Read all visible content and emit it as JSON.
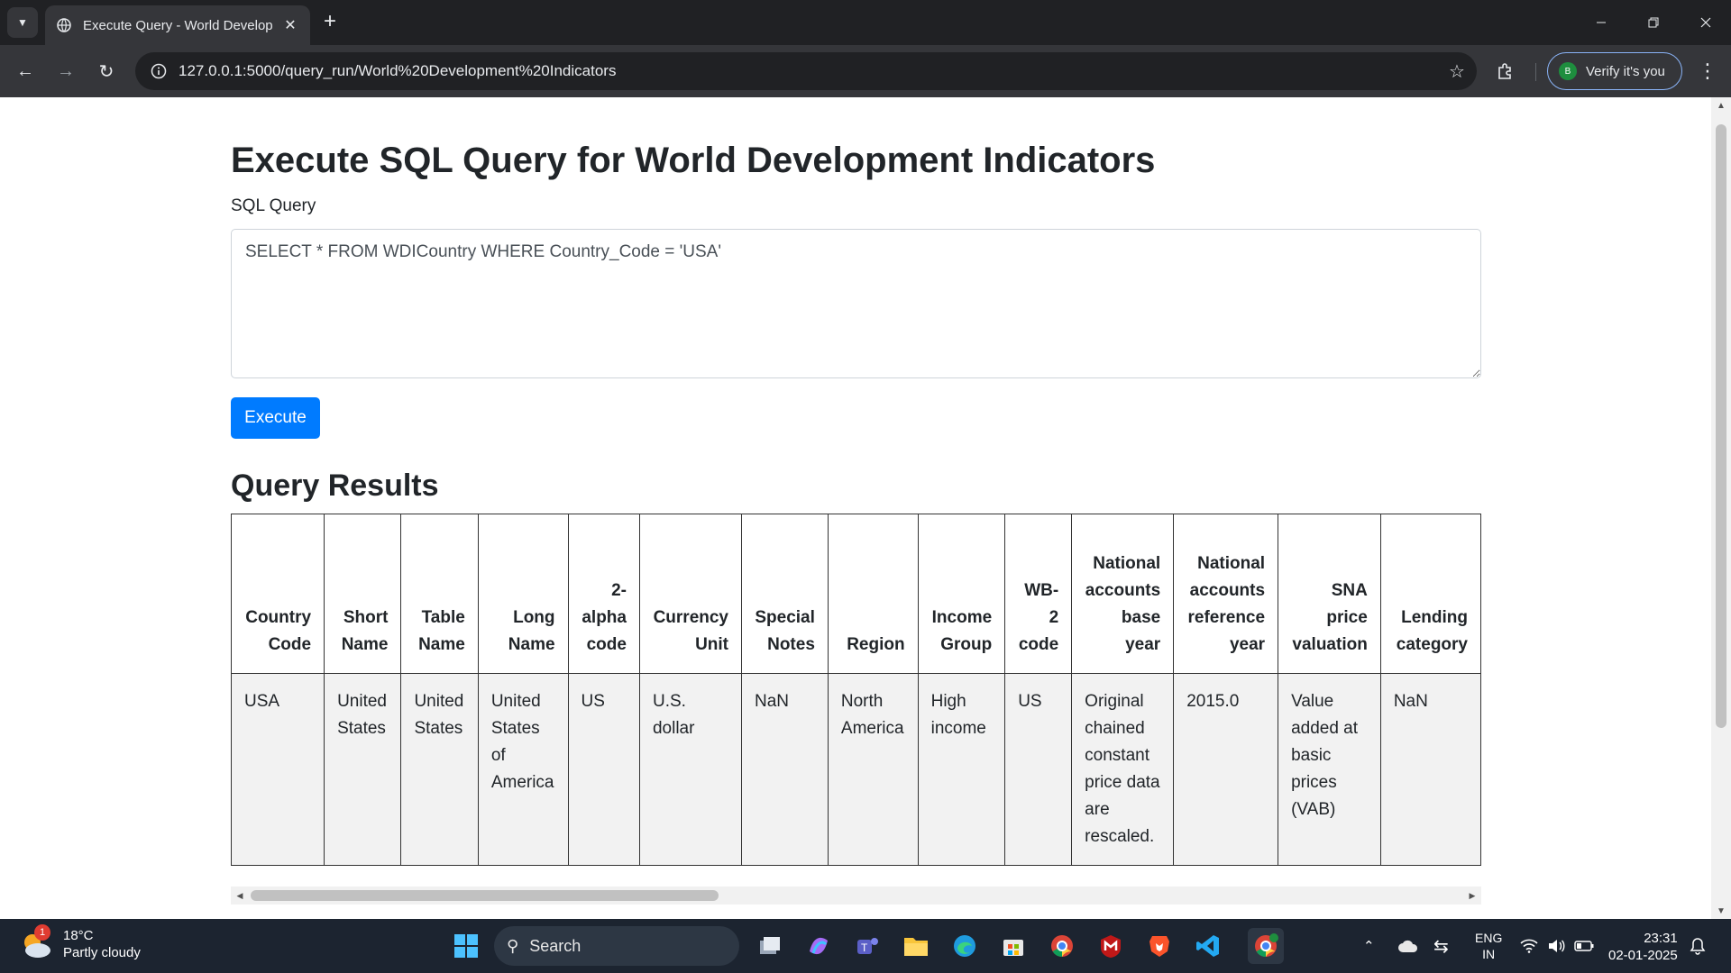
{
  "browser": {
    "tab_title": "Execute Query - World Develop",
    "url": "127.0.0.1:5000/query_run/World%20Development%20Indicators",
    "verify_label": "Verify it's you",
    "profile_initial": "B"
  },
  "page": {
    "title": "Execute SQL Query for World Development Indicators",
    "sql_label": "SQL Query",
    "sql_value": "SELECT * FROM WDICountry WHERE Country_Code = 'USA'",
    "execute_label": "Execute",
    "results_title": "Query Results"
  },
  "table": {
    "headers": [
      "Country Code",
      "Short Name",
      "Table Name",
      "Long Name",
      "2-alpha code",
      "Currency Unit",
      "Special Notes",
      "Region",
      "Income Group",
      "WB-2 code",
      "National accounts base year",
      "National accounts reference year",
      "SNA price valuation",
      "Lending category"
    ],
    "rows": [
      [
        "USA",
        "United States",
        "United States",
        "United States of America",
        "US",
        "U.S. dollar",
        "NaN",
        "North America",
        "High income",
        "US",
        "Original chained constant price data are rescaled.",
        "2015.0",
        "Value added at basic prices (VAB)",
        "NaN"
      ]
    ]
  },
  "taskbar": {
    "temperature": "18°C",
    "weather": "Partly cloudy",
    "weather_badge": "1",
    "search_placeholder": "Search",
    "language_top": "ENG",
    "language_bottom": "IN",
    "time": "23:31",
    "date": "02-01-2025"
  }
}
